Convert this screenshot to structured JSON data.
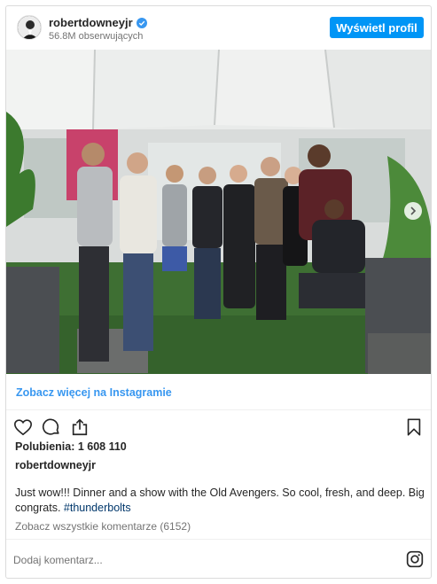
{
  "header": {
    "username": "robertdowneyjr",
    "followers": "56.8M obserwujących",
    "view_profile_label": "Wyświetl profil"
  },
  "photo": {
    "slides": 3,
    "active_slide": 1
  },
  "see_more_label": "Zobacz więcej na Instagramie",
  "likes": "Polubienia: 1 608 110",
  "caption": {
    "username": "robertdowneyjr",
    "text": "Just wow!!! Dinner and a show with the Old Avengers. So cool, fresh, and deep. Big congrats. ",
    "hashtag": "#thunderbolts"
  },
  "comments_link": "Zobacz wszystkie komentarze (6152)",
  "comment_placeholder": "Dodaj komentarz...",
  "colors": {
    "accent": "#0095f6",
    "link": "#3897f0",
    "hashtag": "#00376b",
    "muted": "#737373"
  },
  "icons": [
    "verified-badge-icon",
    "heart-icon",
    "comment-icon",
    "share-icon",
    "bookmark-icon",
    "instagram-icon",
    "chevron-right-icon"
  ]
}
